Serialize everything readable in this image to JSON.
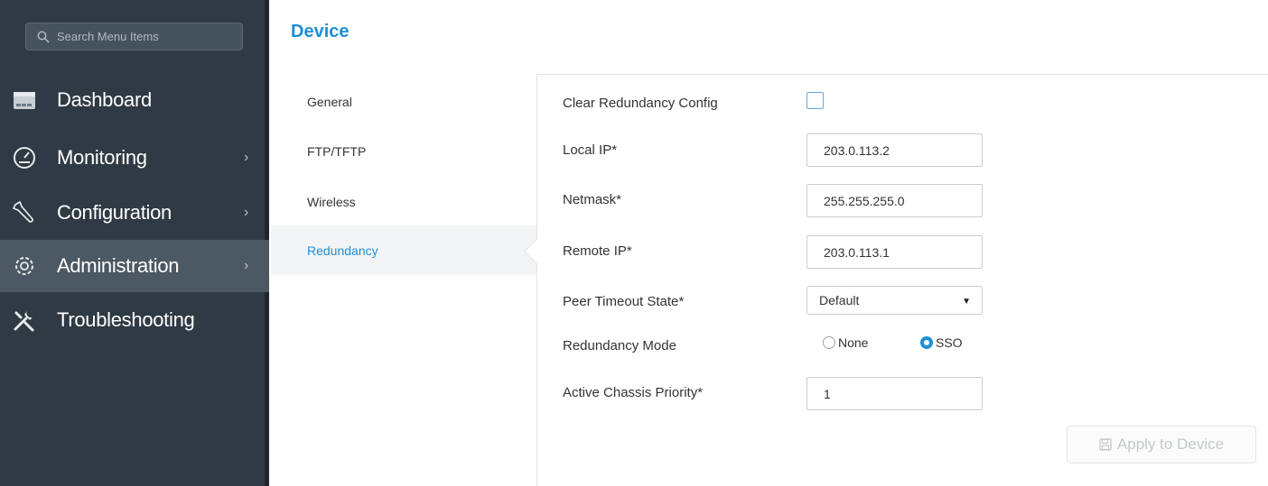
{
  "sidebar": {
    "search_placeholder": "Search Menu Items",
    "items": [
      {
        "label": "Dashboard",
        "icon": "dashboard-icon",
        "has_submenu": false,
        "active": false
      },
      {
        "label": "Monitoring",
        "icon": "gauge-icon",
        "has_submenu": true,
        "active": false
      },
      {
        "label": "Configuration",
        "icon": "wrench-icon",
        "has_submenu": true,
        "active": false
      },
      {
        "label": "Administration",
        "icon": "gear-icon",
        "has_submenu": true,
        "active": true
      },
      {
        "label": "Troubleshooting",
        "icon": "tools-icon",
        "has_submenu": false,
        "active": false
      }
    ]
  },
  "page": {
    "title": "Device"
  },
  "subnav": {
    "items": [
      {
        "label": "General",
        "active": false
      },
      {
        "label": "FTP/TFTP",
        "active": false
      },
      {
        "label": "Wireless",
        "active": false
      },
      {
        "label": "Redundancy",
        "active": true
      }
    ]
  },
  "form": {
    "clear_config_label": "Clear Redundancy Config",
    "clear_config_checked": false,
    "local_ip_label": "Local IP*",
    "local_ip_value": "203.0.113.2",
    "netmask_label": "Netmask*",
    "netmask_value": "255.255.255.0",
    "remote_ip_label": "Remote IP*",
    "remote_ip_value": "203.0.113.1",
    "peer_timeout_label": "Peer Timeout State*",
    "peer_timeout_value": "Default",
    "mode_label": "Redundancy Mode",
    "mode_options": [
      "None",
      "SSO"
    ],
    "mode_selected": "SSO",
    "priority_label": "Active Chassis Priority*",
    "priority_value": "1",
    "apply_label": "Apply to Device"
  },
  "colors": {
    "accent": "#1f8fd5",
    "sidebar_bg": "#2f3a44",
    "sidebar_active": "#4c5863"
  }
}
